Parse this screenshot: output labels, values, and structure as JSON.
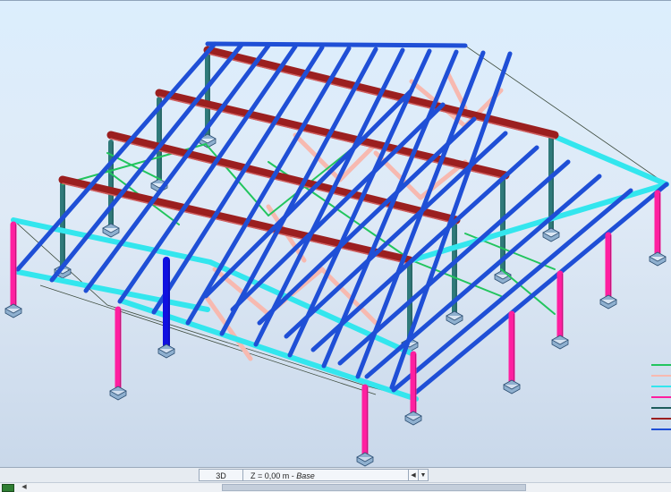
{
  "view_tabs": {
    "view_label": "3D",
    "level_prefix": "Z = 0,00 m - ",
    "level_name": "Base"
  },
  "legend_colors": [
    "#22c55e",
    "#f7b9b0",
    "#33e6ee",
    "#ff1fa0",
    "#1e5c5c",
    "#9b1f1f",
    "#1f4fd6"
  ],
  "member_colors": {
    "rafter": "#1f4fd6",
    "purlin": "#9b1f1f",
    "column": "#2f7a7a",
    "brace": "#22c55e",
    "truss_web": "#f7b9b0",
    "tie_beam": "#33e6ee",
    "outer_column": "#ff1fa0",
    "highlight_column": "#1010e0"
  }
}
